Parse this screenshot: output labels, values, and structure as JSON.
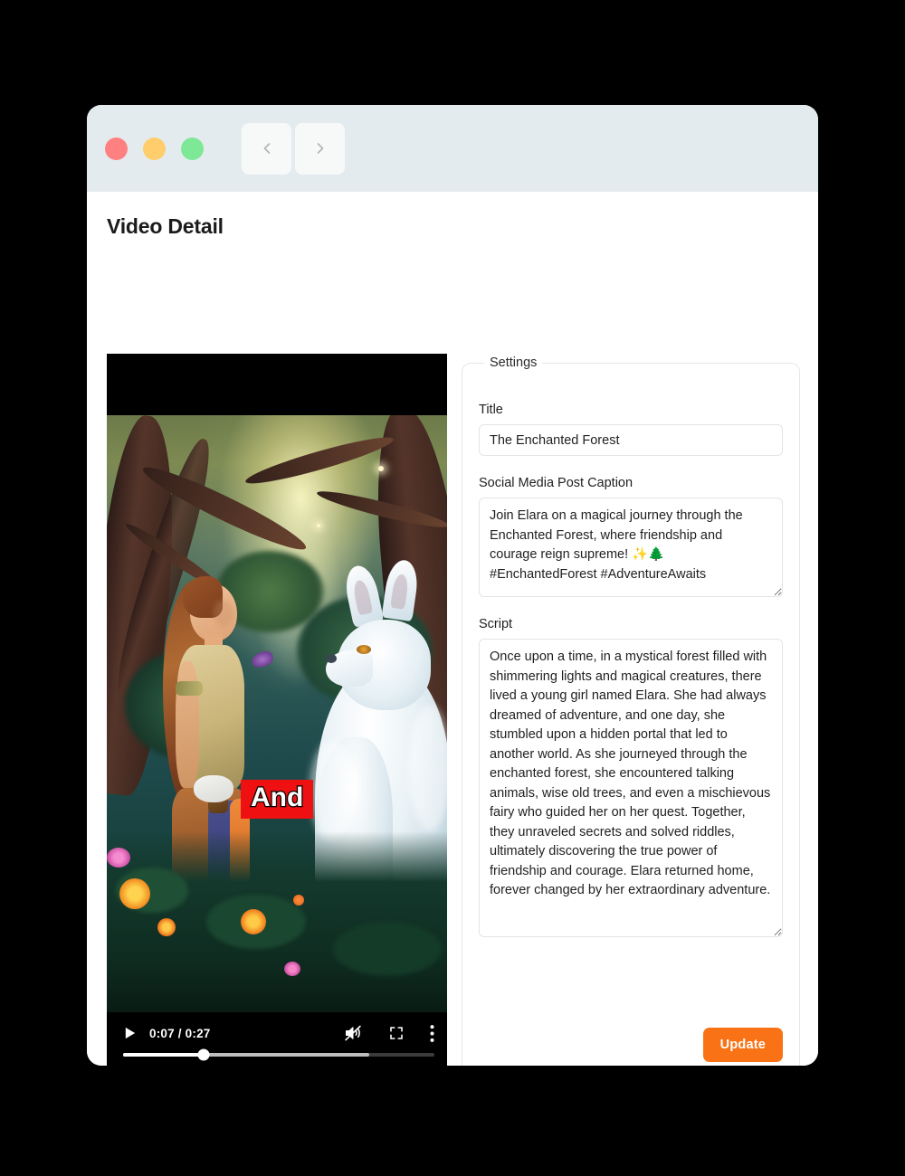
{
  "window": {
    "traffic_lights": [
      {
        "name": "close",
        "color": "#ff8080"
      },
      {
        "name": "minimize",
        "color": "#ffcd6b"
      },
      {
        "name": "maximize",
        "color": "#7ee896"
      }
    ],
    "nav": {
      "back_icon": "chevron-left-icon",
      "forward_icon": "chevron-right-icon"
    }
  },
  "page": {
    "title": "Video Detail"
  },
  "video": {
    "current_time": "0:07",
    "duration": "0:27",
    "time_display": "0:07 / 0:27",
    "played_percent": 26,
    "buffered_percent": 79,
    "muted": true,
    "playing": false,
    "caption_overlay": "And",
    "caption_bg_color": "#ef1111",
    "controls": {
      "play_icon": "play-icon",
      "mute_icon": "volume-muted-icon",
      "fullscreen_icon": "fullscreen-icon",
      "more_icon": "more-vertical-icon"
    }
  },
  "settings": {
    "legend": "Settings",
    "title_label": "Title",
    "title_value": "The Enchanted Forest",
    "caption_label": "Social Media Post Caption",
    "caption_value": "Join Elara on a magical journey through the Enchanted Forest, where friendship and courage reign supreme! ✨🌲 #EnchantedForest #AdventureAwaits",
    "script_label": "Script",
    "script_value": "Once upon a time, in a mystical forest filled with shimmering lights and magical creatures, there lived a young girl named Elara. She had always dreamed of adventure, and one day, she stumbled upon a hidden portal that led to another world. As she journeyed through the enchanted forest, she encountered talking animals, wise old trees, and even a mischievous fairy who guided her on her quest. Together, they unraveled secrets and solved riddles, ultimately discovering the true power of friendship and courage. Elara returned home, forever changed by her extraordinary adventure.",
    "update_label": "Update",
    "update_color": "#f97316"
  }
}
